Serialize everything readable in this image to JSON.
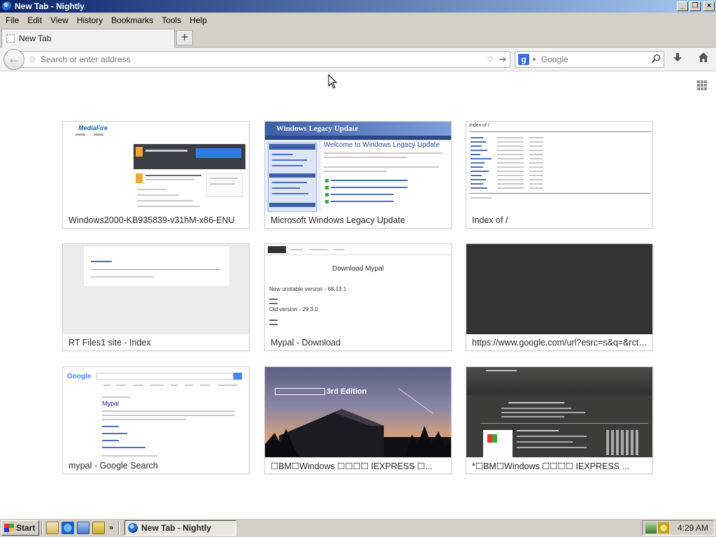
{
  "window": {
    "title": "New Tab - Nightly"
  },
  "menu": [
    {
      "label": "File"
    },
    {
      "label": "Edit"
    },
    {
      "label": "View"
    },
    {
      "label": "History"
    },
    {
      "label": "Bookmarks"
    },
    {
      "label": "Tools"
    },
    {
      "label": "Help"
    }
  ],
  "tabs": [
    {
      "label": "New Tab"
    }
  ],
  "newtab_symbol": "+",
  "urlbar": {
    "placeholder": "Search or enter address"
  },
  "search": {
    "placeholder": "Google",
    "engine_letter": "g"
  },
  "tiles": [
    {
      "title": "Windows2000-KB935839-v31hM-x86-ENU"
    },
    {
      "title": "Microsoft Windows Legacy Update"
    },
    {
      "title": "Index of /"
    },
    {
      "title": "RT Files1 site - Index"
    },
    {
      "title": "Mypal - Download"
    },
    {
      "title": "https://www.google.com/url?esrc=s&q=&rct=j..."
    },
    {
      "title": "mypal - Google Search"
    },
    {
      "title": "☐BM☐Windows ☐☐☐☐ IEXPRESS ☐..."
    },
    {
      "title": "*☐BM☐Windows ☐☐☐☐ IEXPRESS ..."
    }
  ],
  "thumbs": {
    "mediafire_logo": "MediaFire",
    "wlu_header": "Windows Legacy Update",
    "wlu_welcome": "Welcome to Windows Legacy Update",
    "index_heading": "Index of /",
    "mypal_heading": "Download Mypal",
    "mypal_unstable": "New unstable version - 68.13.1",
    "mypal_old": "Old version - 29.3.0",
    "google_logo": "Google",
    "google_result": "Mypal",
    "edition_text": "3rd Edition"
  },
  "taskbar": {
    "start_label": "Start",
    "more": "»",
    "task_label": "New Tab - Nightly",
    "clock": "4:29 AM"
  },
  "colors": {
    "titlebar_start": "#0a246a",
    "titlebar_end": "#a6caf0",
    "chrome": "#d4d0c8",
    "search_engine": "#3b6fd4"
  }
}
